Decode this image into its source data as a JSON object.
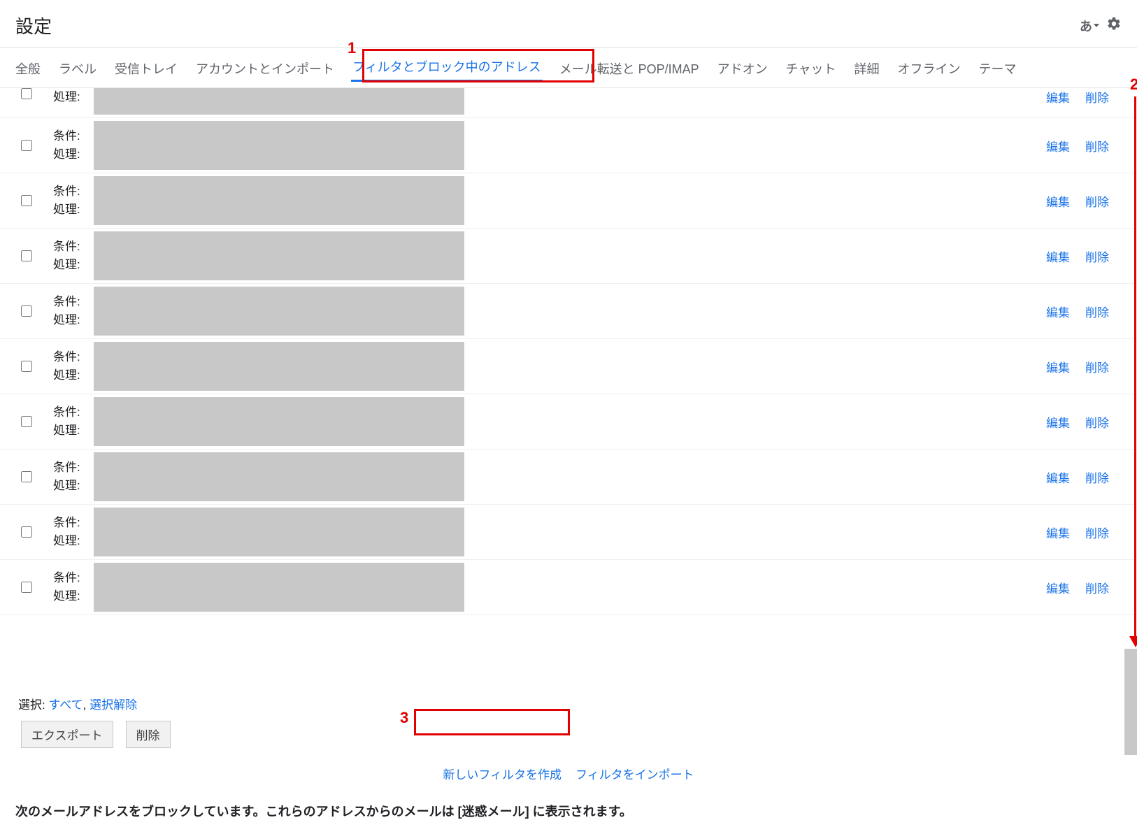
{
  "header": {
    "title": "設定",
    "ime": "あ"
  },
  "tabs": [
    {
      "label": "全般",
      "active": false
    },
    {
      "label": "ラベル",
      "active": false
    },
    {
      "label": "受信トレイ",
      "active": false
    },
    {
      "label": "アカウントとインポート",
      "active": false
    },
    {
      "label": "フィルタとブロック中のアドレス",
      "active": true
    },
    {
      "label": "メール転送と POP/IMAP",
      "active": false
    },
    {
      "label": "アドオン",
      "active": false
    },
    {
      "label": "チャット",
      "active": false
    },
    {
      "label": "詳細",
      "active": false
    },
    {
      "label": "オフライン",
      "active": false
    },
    {
      "label": "テーマ",
      "active": false
    }
  ],
  "filter_labels": {
    "condition": "条件:",
    "action": "処理:"
  },
  "filter_actions": {
    "edit": "編集",
    "delete": "削除"
  },
  "filter_count": 10,
  "select_row": {
    "prefix": "選択:",
    "all": "すべて",
    "separator": ",",
    "none": "選択解除"
  },
  "buttons": {
    "export": "エクスポート",
    "delete": "削除"
  },
  "bottom_links": {
    "create": "新しいフィルタを作成",
    "import": "フィルタをインポート"
  },
  "blocked_message": "次のメールアドレスをブロックしています。これらのアドレスからのメールは [迷惑メール] に表示されます。",
  "callouts": {
    "one": "1",
    "two": "2",
    "three": "3"
  }
}
